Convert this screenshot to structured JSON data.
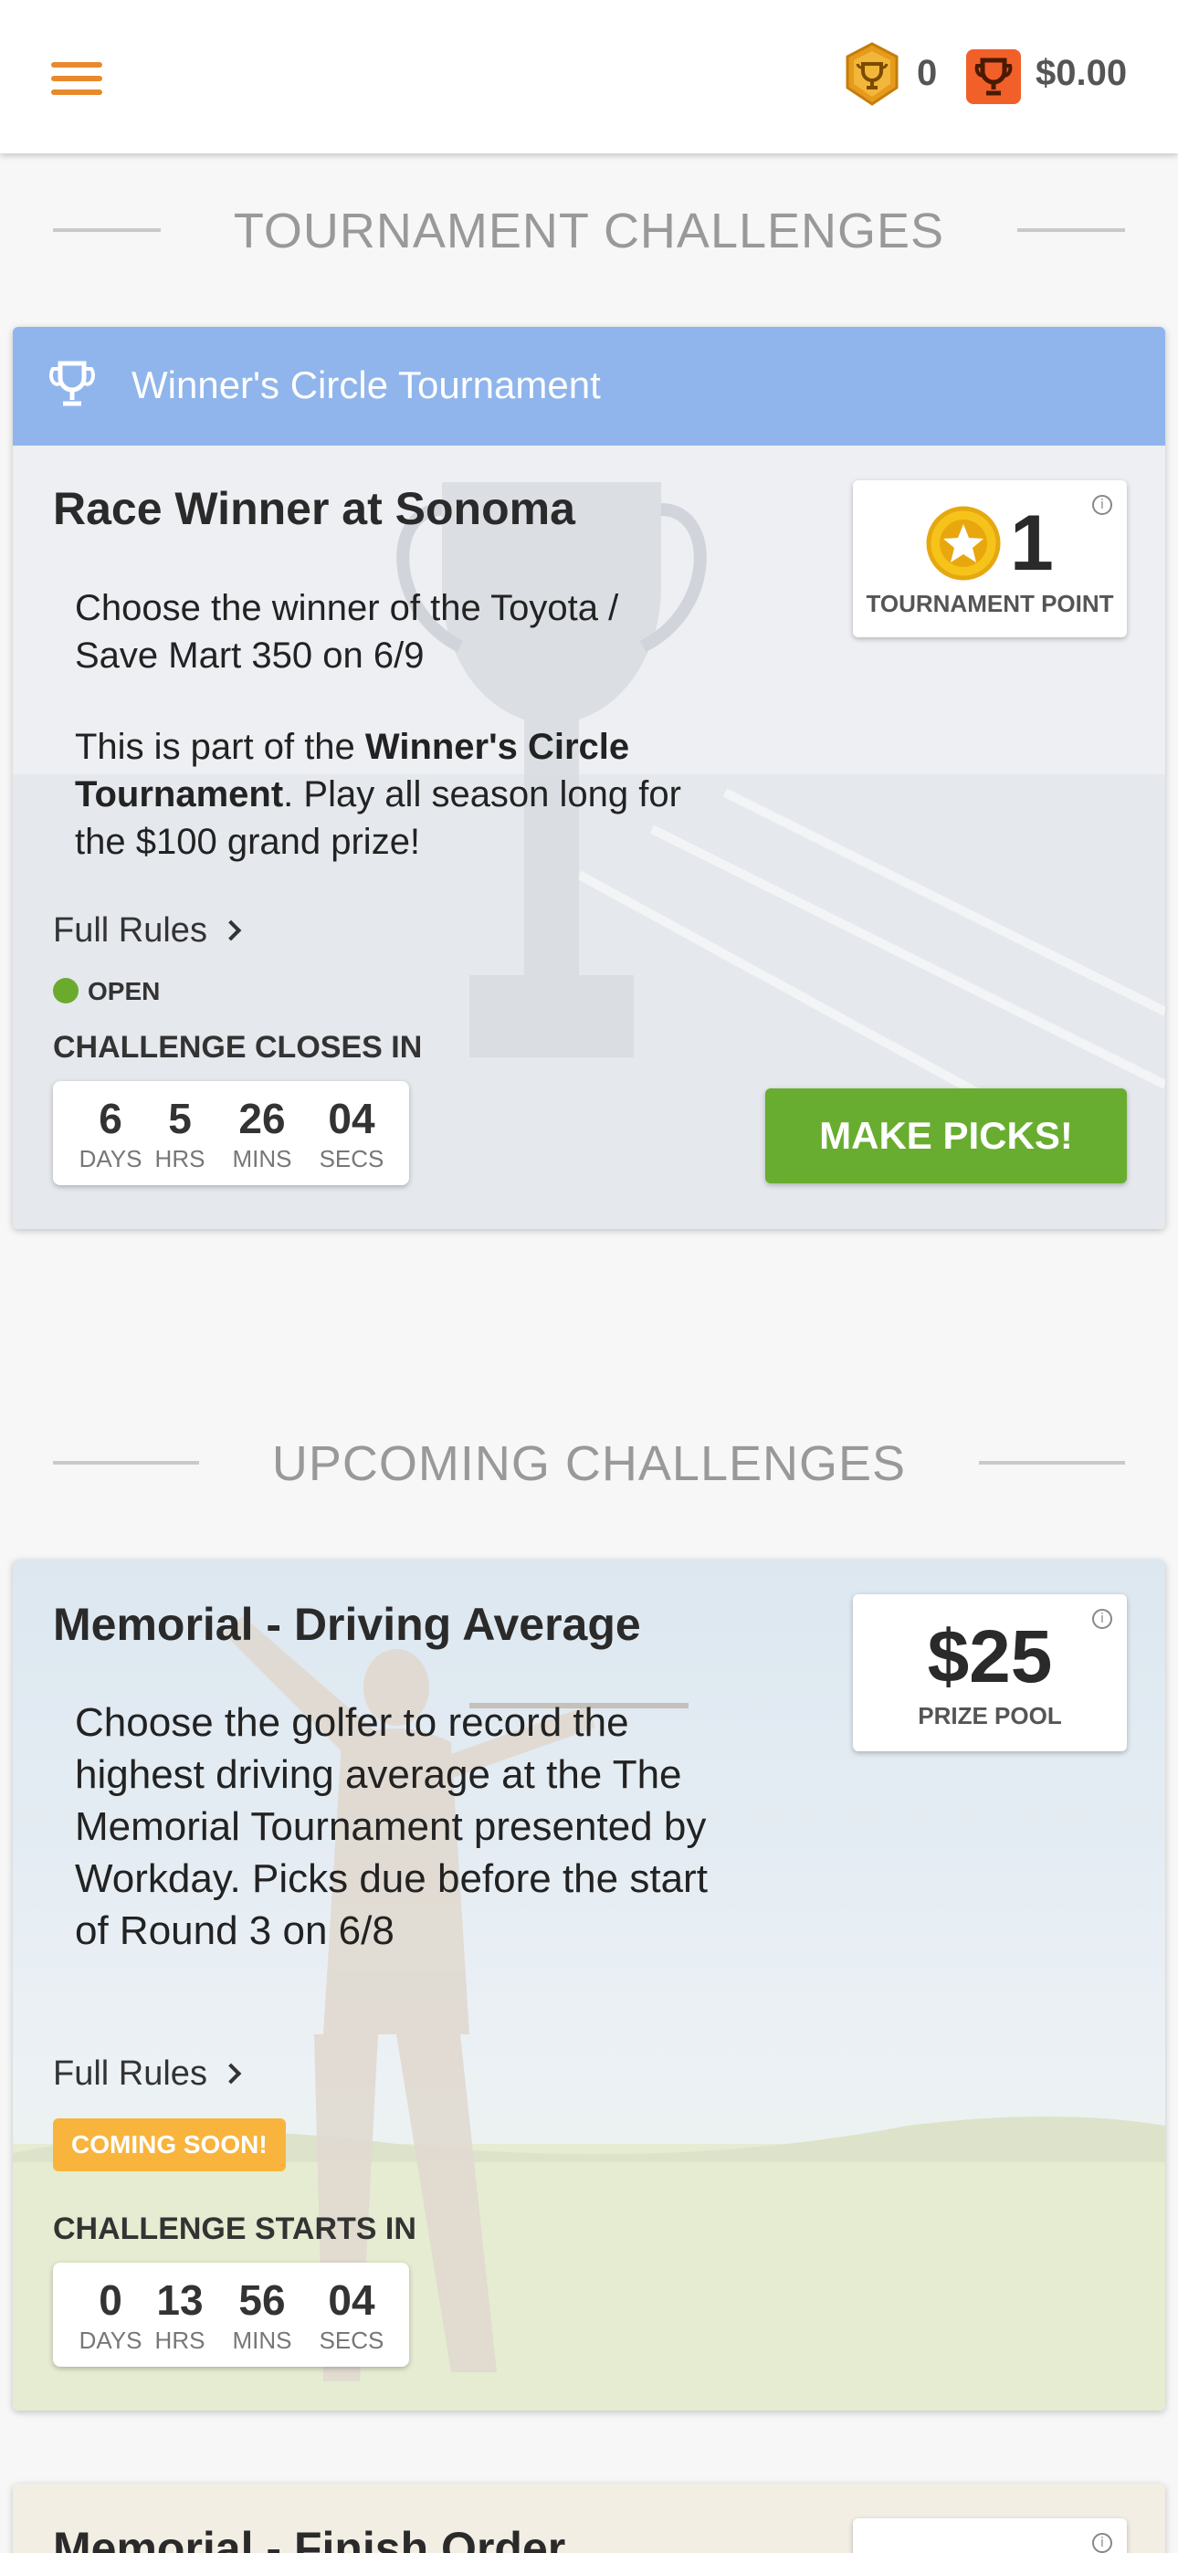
{
  "header": {
    "coin_count": "0",
    "balance": "$0.00",
    "menu_icon": "hamburger-menu-icon",
    "coin_icon": "trophy-coin-icon",
    "wallet_icon": "trophy-wallet-icon",
    "accent_color": "#e8892d"
  },
  "sections": {
    "tournament_title": "TOURNAMENT CHALLENGES",
    "upcoming_title": "UPCOMING CHALLENGES"
  },
  "tournament_card": {
    "header_label": "Winner's Circle Tournament",
    "header_color": "#8fb5ec",
    "title": "Race Winner at Sonoma",
    "description_1": "Choose the winner of the Toyota / Save Mart 350 on 6/9",
    "description_2_pre": "This is part of the ",
    "description_2_bold": "Winner's Circle Tournament",
    "description_2_post": ". Play all season long for the $100 grand prize!",
    "rules_label": "Full Rules",
    "status": "OPEN",
    "status_color": "#6aab2e",
    "countdown_label": "CHALLENGE CLOSES IN",
    "countdown": {
      "days": "6",
      "hrs": "5",
      "mins": "26",
      "secs": "04",
      "days_label": "DAYS",
      "hrs_label": "HRS",
      "mins_label": "MINS",
      "secs_label": "SECS"
    },
    "points_value": "1",
    "points_label": "TOURNAMENT POINT",
    "cta_label": "MAKE PICKS!",
    "cta_color": "#68ad2f"
  },
  "upcoming_card_1": {
    "title": "Memorial - Driving Average",
    "description": "Choose the golfer to record the highest driving average at the The Memorial Tournament presented by Workday. Picks due before the start of Round 3 on 6/8",
    "rules_label": "Full Rules",
    "badge": "COMING SOON!",
    "badge_color": "#f8b43c",
    "countdown_label": "CHALLENGE STARTS IN",
    "countdown": {
      "days": "0",
      "hrs": "13",
      "mins": "56",
      "secs": "04",
      "days_label": "DAYS",
      "hrs_label": "HRS",
      "mins_label": "MINS",
      "secs_label": "SECS"
    },
    "prize_value": "$25",
    "prize_label": "PRIZE POOL"
  },
  "upcoming_card_2": {
    "title": "Memorial - Finish Order"
  }
}
